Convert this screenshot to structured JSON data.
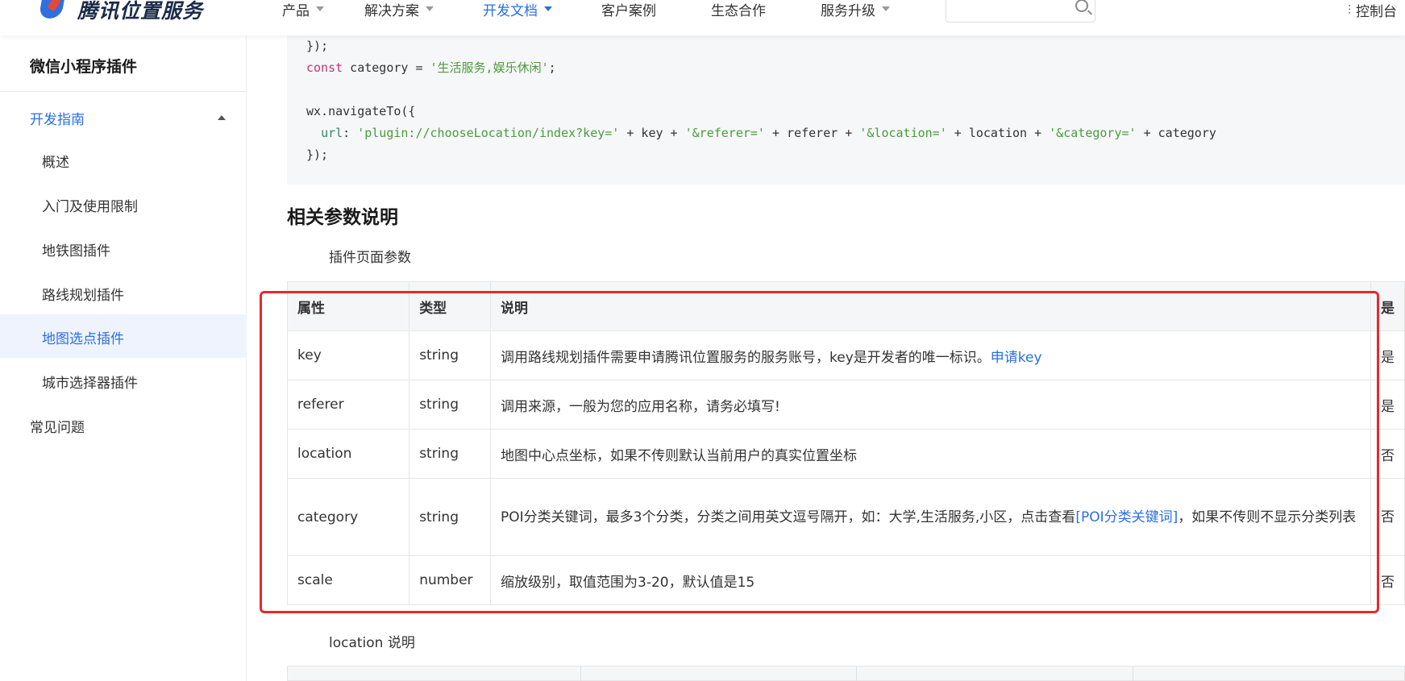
{
  "header": {
    "brand": "腾讯位置服务",
    "nav": [
      {
        "label": "产品",
        "dropdown": true,
        "active": false
      },
      {
        "label": "解决方案",
        "dropdown": true,
        "active": false
      },
      {
        "label": "开发文档",
        "dropdown": true,
        "active": true
      },
      {
        "label": "客户案例",
        "dropdown": false,
        "active": false
      },
      {
        "label": "生态合作",
        "dropdown": false,
        "active": false
      },
      {
        "label": "服务升级",
        "dropdown": true,
        "active": false
      }
    ],
    "search_placeholder": "",
    "console_label": "控制台"
  },
  "sidebar": {
    "title": "微信小程序插件",
    "group": "开发指南",
    "items": [
      "概述",
      "入门及使用限制",
      "地铁图插件",
      "路线规划插件",
      "地图选点插件",
      "城市选择器插件"
    ],
    "active_item": "地图选点插件",
    "faq": "常见问题"
  },
  "code": {
    "line1": "});",
    "line2_kw": "const",
    "line2_rest": " category = ",
    "line2_str": "'生活服务,娱乐休闲'",
    "line2_end": ";",
    "line4": "wx.navigateTo({",
    "line5_prop": "url",
    "line5_a": ": ",
    "line5_s1": "'plugin://chooseLocation/index?key='",
    "line5_b": " + key + ",
    "line5_s2": "'&referer='",
    "line5_c": " + referer + ",
    "line5_s3": "'&location='",
    "line5_d": " + location + ",
    "line5_s4": "'&category='",
    "line5_e": " + category",
    "line6": "});"
  },
  "section": {
    "title": "相关参数说明",
    "subtitle": "插件页面参数",
    "subtitle2": "location 说明"
  },
  "table": {
    "headers": [
      "属性",
      "类型",
      "说明",
      "是"
    ],
    "rows": [
      {
        "attr": "key",
        "type": "string",
        "desc": "调用路线规划插件需要申请腾讯位置服务的服务账号，key是开发者的唯一标识。",
        "link": "申请key",
        "desc_after": "",
        "req": "是"
      },
      {
        "attr": "referer",
        "type": "string",
        "desc": "调用来源，一般为您的应用名称，请务必填写!",
        "link": "",
        "desc_after": "",
        "req": "是"
      },
      {
        "attr": "location",
        "type": "string",
        "desc": "地图中心点坐标，如果不传则默认当前用户的真实位置坐标",
        "link": "",
        "desc_after": "",
        "req": "否"
      },
      {
        "attr": "category",
        "type": "string",
        "desc": "POI分类关键词，最多3个分类，分类之间用英文逗号隔开，如：大学,生活服务,小区，点击查看",
        "link": "[POI分类关键词]",
        "desc_after": "，如果不传则不显示分类列表",
        "req": "否"
      },
      {
        "attr": "scale",
        "type": "number",
        "desc": "缩放级别，取值范围为3-20，默认值是15",
        "link": "",
        "desc_after": "",
        "req": "否"
      }
    ]
  },
  "colors": {
    "accent": "#2a6fe0",
    "highlight": "#e8282b"
  }
}
